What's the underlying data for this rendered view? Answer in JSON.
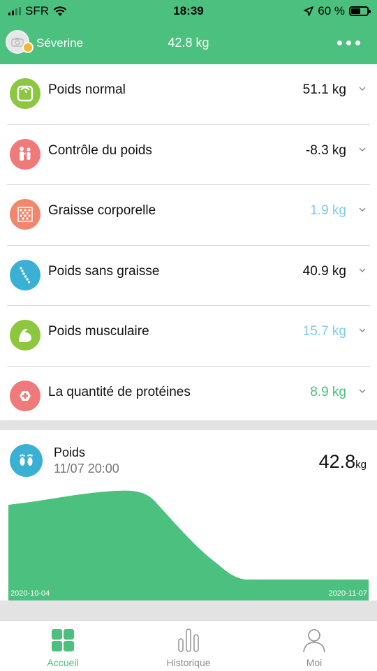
{
  "status": {
    "carrier": "SFR",
    "time": "18:39",
    "battery": "60 %",
    "battery_level": 0.6
  },
  "header": {
    "user_name": "Séverine",
    "weight": "42.8 kg",
    "icons": [
      "camera-icon",
      "more-icon"
    ]
  },
  "metrics": [
    {
      "label": "Poids normal",
      "value": "51.1 kg",
      "value_color": "#111111",
      "icon": "scale-icon",
      "icon_color": "#8DC63F"
    },
    {
      "label": "Contrôle du poids",
      "value": "-8.3 kg",
      "value_color": "#111111",
      "icon": "people-icon",
      "icon_color": "#F07A7A"
    },
    {
      "label": "Graisse corporelle",
      "value": "1.9 kg",
      "value_color": "#7FCBEA",
      "icon": "fat-icon",
      "icon_color": "#F0866B"
    },
    {
      "label": "Poids sans graisse",
      "value": "40.9 kg",
      "value_color": "#111111",
      "icon": "spine-icon",
      "icon_color": "#3AB0D5"
    },
    {
      "label": "Poids musculaire",
      "value": "15.7 kg",
      "value_color": "#7FCBEA",
      "icon": "muscle-icon",
      "icon_color": "#8DC63F"
    },
    {
      "label": "La quantité de protéines",
      "value": "8.9 kg",
      "value_color": "#4CC07E",
      "icon": "protein-icon",
      "icon_color": "#F07A7A"
    }
  ],
  "weight_card": {
    "title": "Poids",
    "datetime": "11/07 20:00",
    "value": "42.8",
    "unit": "kg",
    "icon": "feet-icon",
    "start_label": "2020-10-04",
    "end_label": "2020-11-07"
  },
  "chart_data": {
    "type": "area",
    "x": [
      "2020-10-04",
      "2020-11-07"
    ],
    "color": "#4CC07E",
    "note_values": "No y-axis values are printed; shape shows a higher plateau then a drop to a lower level."
  },
  "tabs": [
    {
      "label": "Accueil",
      "icon": "home-grid-icon",
      "active": true
    },
    {
      "label": "Historique",
      "icon": "bar-chart-icon",
      "active": false
    },
    {
      "label": "Moi",
      "icon": "person-icon",
      "active": false
    }
  ],
  "colors": {
    "accent": "#4CC07E"
  }
}
